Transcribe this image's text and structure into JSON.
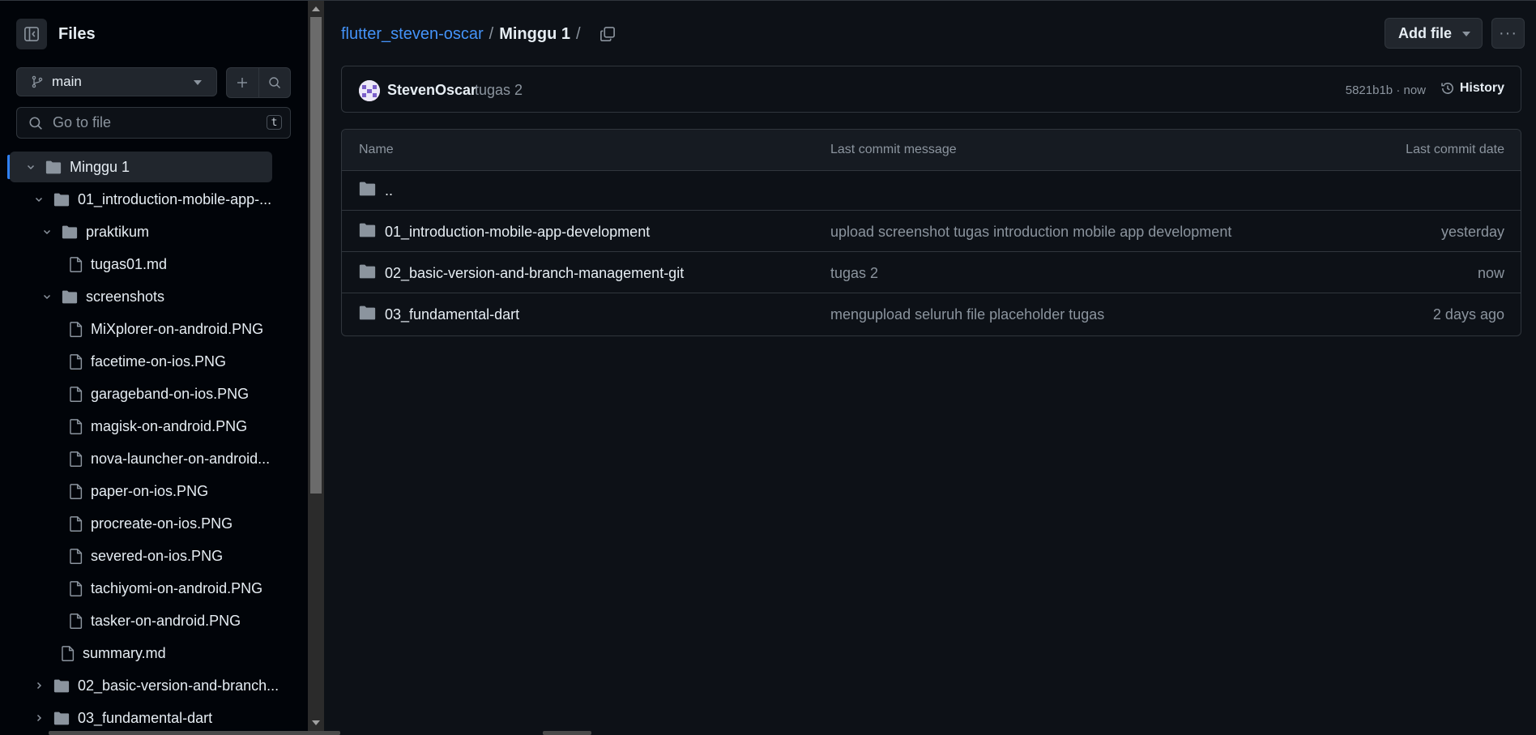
{
  "sidebar": {
    "title": "Files",
    "branch": "main",
    "search_placeholder": "Go to file",
    "search_shortcut": "t",
    "tree": [
      {
        "label": "Minggu 1",
        "type": "folder",
        "expanded": true,
        "selected": true
      },
      {
        "label": "01_introduction-mobile-app-...",
        "type": "folder",
        "expanded": true
      },
      {
        "label": "praktikum",
        "type": "folder",
        "expanded": true
      },
      {
        "label": "tugas01.md",
        "type": "file"
      },
      {
        "label": "screenshots",
        "type": "folder",
        "expanded": true
      },
      {
        "label": "MiXplorer-on-android.PNG",
        "type": "file"
      },
      {
        "label": "facetime-on-ios.PNG",
        "type": "file"
      },
      {
        "label": "garageband-on-ios.PNG",
        "type": "file"
      },
      {
        "label": "magisk-on-android.PNG",
        "type": "file"
      },
      {
        "label": "nova-launcher-on-android...",
        "type": "file"
      },
      {
        "label": "paper-on-ios.PNG",
        "type": "file"
      },
      {
        "label": "procreate-on-ios.PNG",
        "type": "file"
      },
      {
        "label": "severed-on-ios.PNG",
        "type": "file"
      },
      {
        "label": "tachiyomi-on-android.PNG",
        "type": "file"
      },
      {
        "label": "tasker-on-android.PNG",
        "type": "file"
      },
      {
        "label": "summary.md",
        "type": "file"
      },
      {
        "label": "02_basic-version-and-branch...",
        "type": "folder",
        "expanded": false
      },
      {
        "label": "03_fundamental-dart",
        "type": "folder",
        "expanded": false
      }
    ]
  },
  "breadcrumb": {
    "repo": "flutter_steven-oscar",
    "separator": "/",
    "current": "Minggu 1",
    "trailing": "/"
  },
  "toolbar": {
    "add_file_label": "Add file",
    "more_label": "···"
  },
  "commit": {
    "author": "StevenOscar",
    "message": "tugas 2",
    "meta": "5821b1b · now",
    "history_label": "History"
  },
  "table": {
    "headers": {
      "name": "Name",
      "message": "Last commit message",
      "date": "Last commit date"
    },
    "rows": [
      {
        "name": "..",
        "message": "",
        "date": ""
      },
      {
        "name": "01_introduction-mobile-app-development",
        "message": "upload screenshot tugas introduction mobile app development",
        "date": "yesterday"
      },
      {
        "name": "02_basic-version-and-branch-management-git",
        "message": "tugas 2",
        "date": "now"
      },
      {
        "name": "03_fundamental-dart",
        "message": "mengupload seluruh file placeholder tugas",
        "date": "2 days ago"
      }
    ]
  },
  "colors": {
    "background": "#0d1117",
    "sidebar_bg": "#010409",
    "accent": "#2f81f7",
    "link": "#4493f8",
    "border": "#30363d",
    "muted_text": "#8b949e"
  }
}
